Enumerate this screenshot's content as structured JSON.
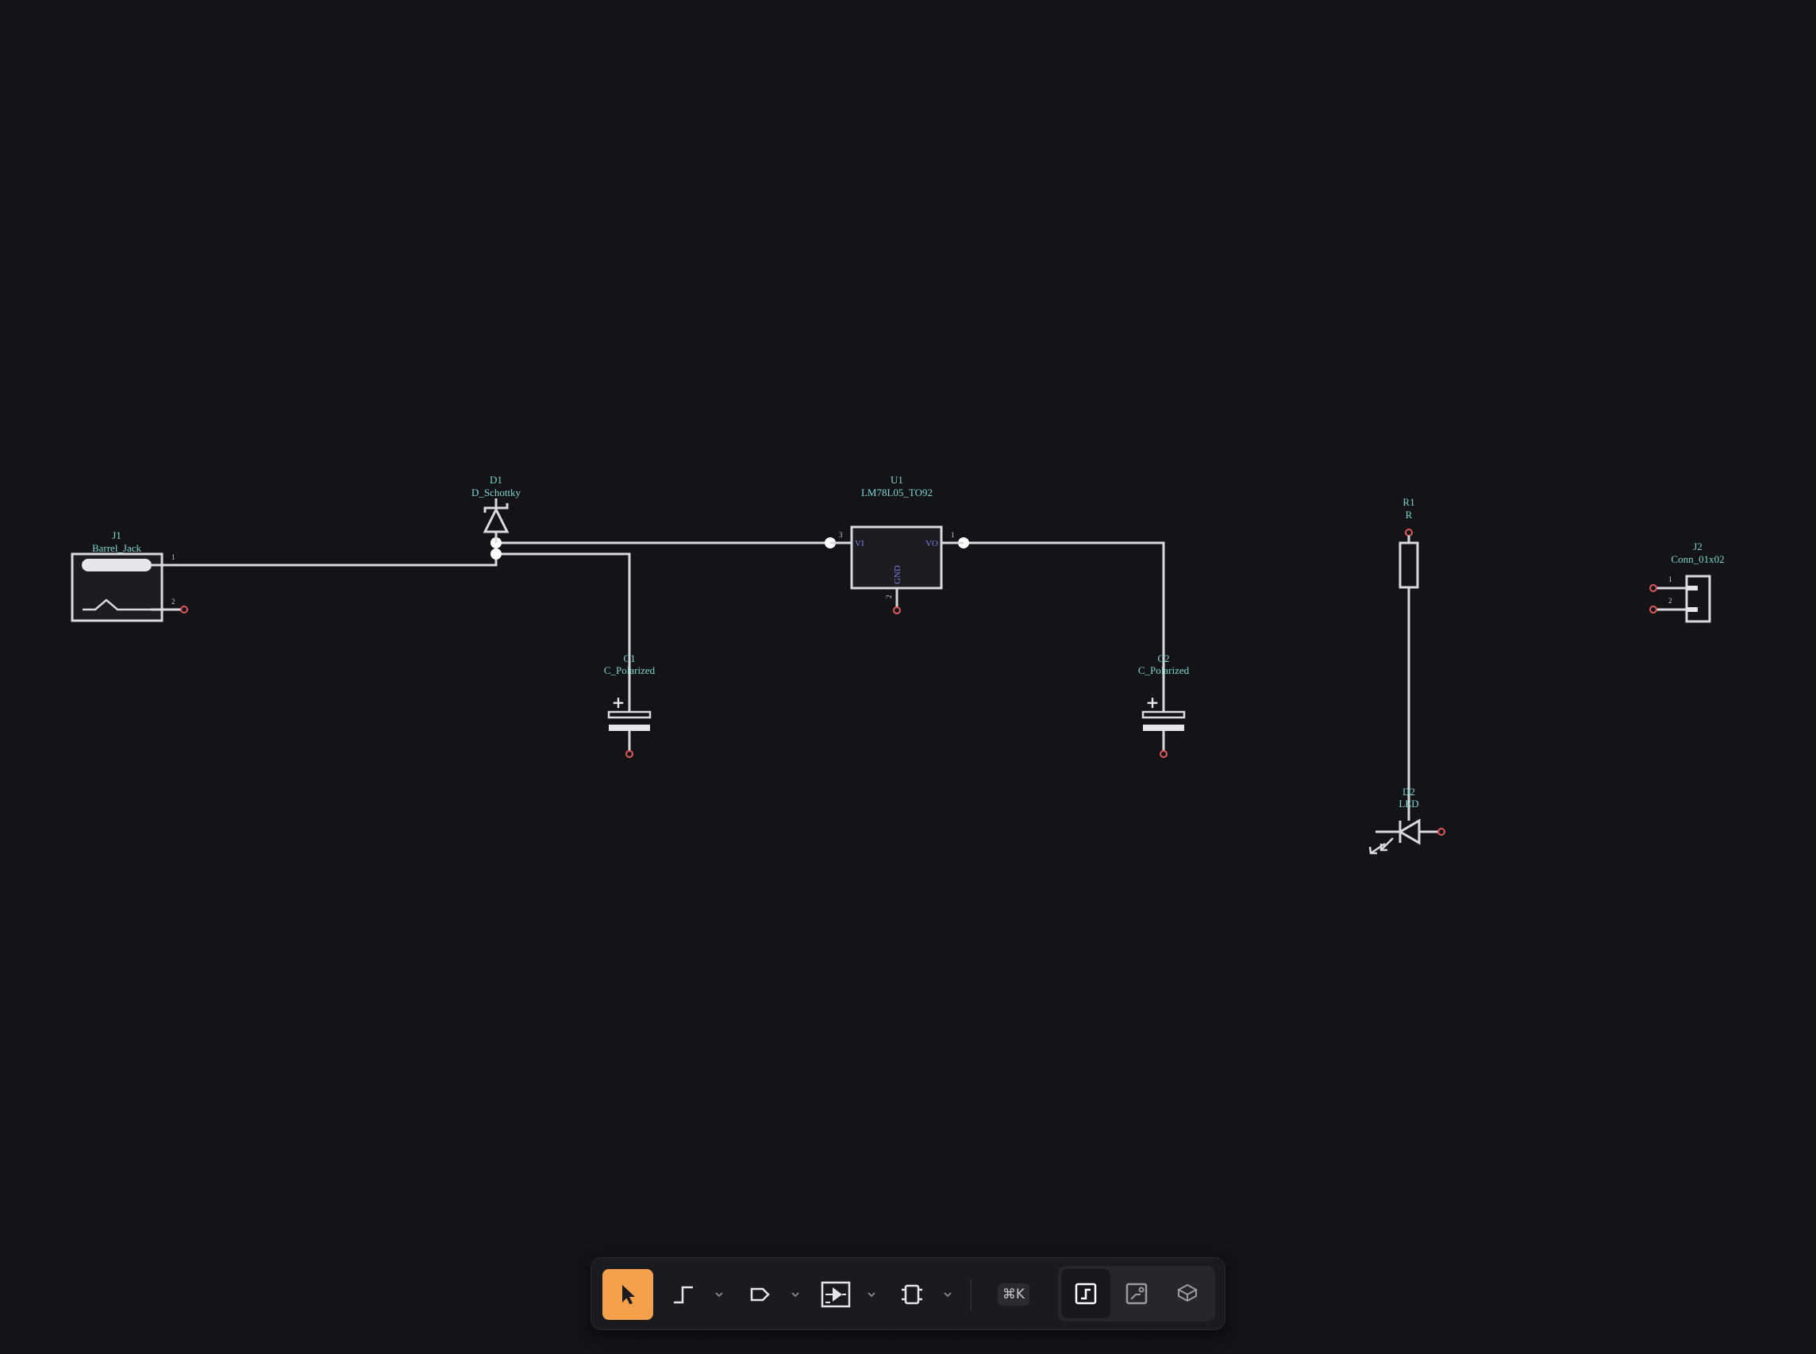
{
  "schematic": {
    "components": {
      "J1": {
        "ref": "J1",
        "value": "Barrel_Jack",
        "pins": [
          "1",
          "2"
        ]
      },
      "D1": {
        "ref": "D1",
        "value": "D_Schottky"
      },
      "U1": {
        "ref": "U1",
        "value": "LM78L05_TO92",
        "pins": [
          "3",
          "1",
          "2"
        ],
        "pin_names": [
          "VI",
          "VO",
          "GND"
        ]
      },
      "C1": {
        "ref": "C1",
        "value": "C_Polarized",
        "polarity": "+"
      },
      "C2": {
        "ref": "C2",
        "value": "C_Polarized",
        "polarity": "+"
      },
      "R1": {
        "ref": "R1",
        "value": "R"
      },
      "D2": {
        "ref": "D2",
        "value": "LED"
      },
      "J2": {
        "ref": "J2",
        "value": "Conn_01x02",
        "pins": [
          "1",
          "2"
        ]
      }
    }
  },
  "toolbar": {
    "tools": [
      {
        "name": "select-tool",
        "icon": "cursor-arrow-icon",
        "active": true
      },
      {
        "name": "wire-tool",
        "icon": "wire-step-icon"
      },
      {
        "name": "net-label-tool",
        "icon": "net-label-icon"
      },
      {
        "name": "symbol-tool",
        "icon": "symbol-buffer-icon"
      },
      {
        "name": "component-tool",
        "icon": "chip-icon"
      }
    ],
    "shortcut": "⌘K",
    "views": [
      {
        "name": "schematic-view",
        "icon": "schematic-view-icon",
        "selected": true
      },
      {
        "name": "pcb-view",
        "icon": "pcb-view-icon"
      },
      {
        "name": "3d-view",
        "icon": "3d-view-icon"
      }
    ],
    "accent": "#f5a04a"
  },
  "colors": {
    "background": "#131318",
    "wire": "#d9d9de",
    "label": "#7fd6d0",
    "pin_end": "#e05a5a",
    "pin_name": "#7c7fe0"
  }
}
